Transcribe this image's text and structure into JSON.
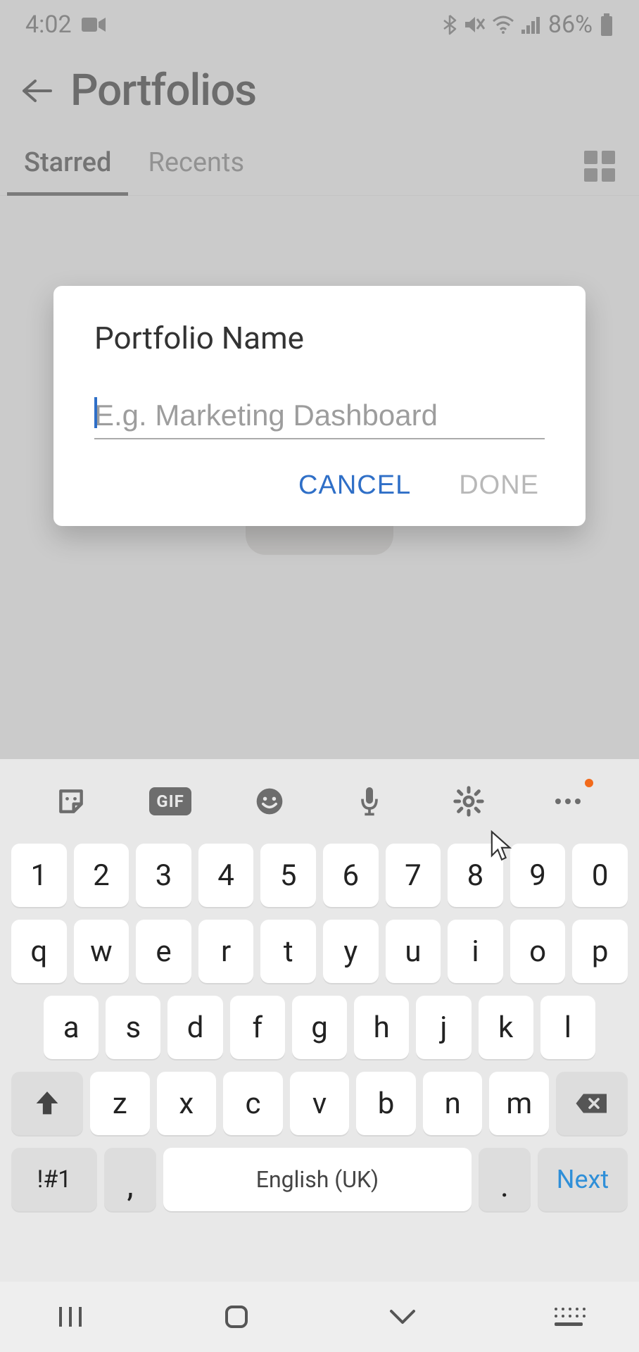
{
  "status": {
    "time": "4:02",
    "battery": "86%"
  },
  "header": {
    "title": "Portfolios"
  },
  "tabs": {
    "starred": "Starred",
    "recents": "Recents"
  },
  "dialog": {
    "title": "Portfolio Name",
    "placeholder": "E.g. Marketing Dashboard",
    "value": "",
    "cancel": "CANCEL",
    "done": "DONE"
  },
  "keyboard": {
    "row1": [
      "1",
      "2",
      "3",
      "4",
      "5",
      "6",
      "7",
      "8",
      "9",
      "0"
    ],
    "row2": [
      "q",
      "w",
      "e",
      "r",
      "t",
      "y",
      "u",
      "i",
      "o",
      "p"
    ],
    "row3": [
      "a",
      "s",
      "d",
      "f",
      "g",
      "h",
      "j",
      "k",
      "l"
    ],
    "row4": [
      "z",
      "x",
      "c",
      "v",
      "b",
      "n",
      "m"
    ],
    "sym": "!#1",
    "comma": ",",
    "space": "English (UK)",
    "period": ".",
    "next": "Next"
  }
}
